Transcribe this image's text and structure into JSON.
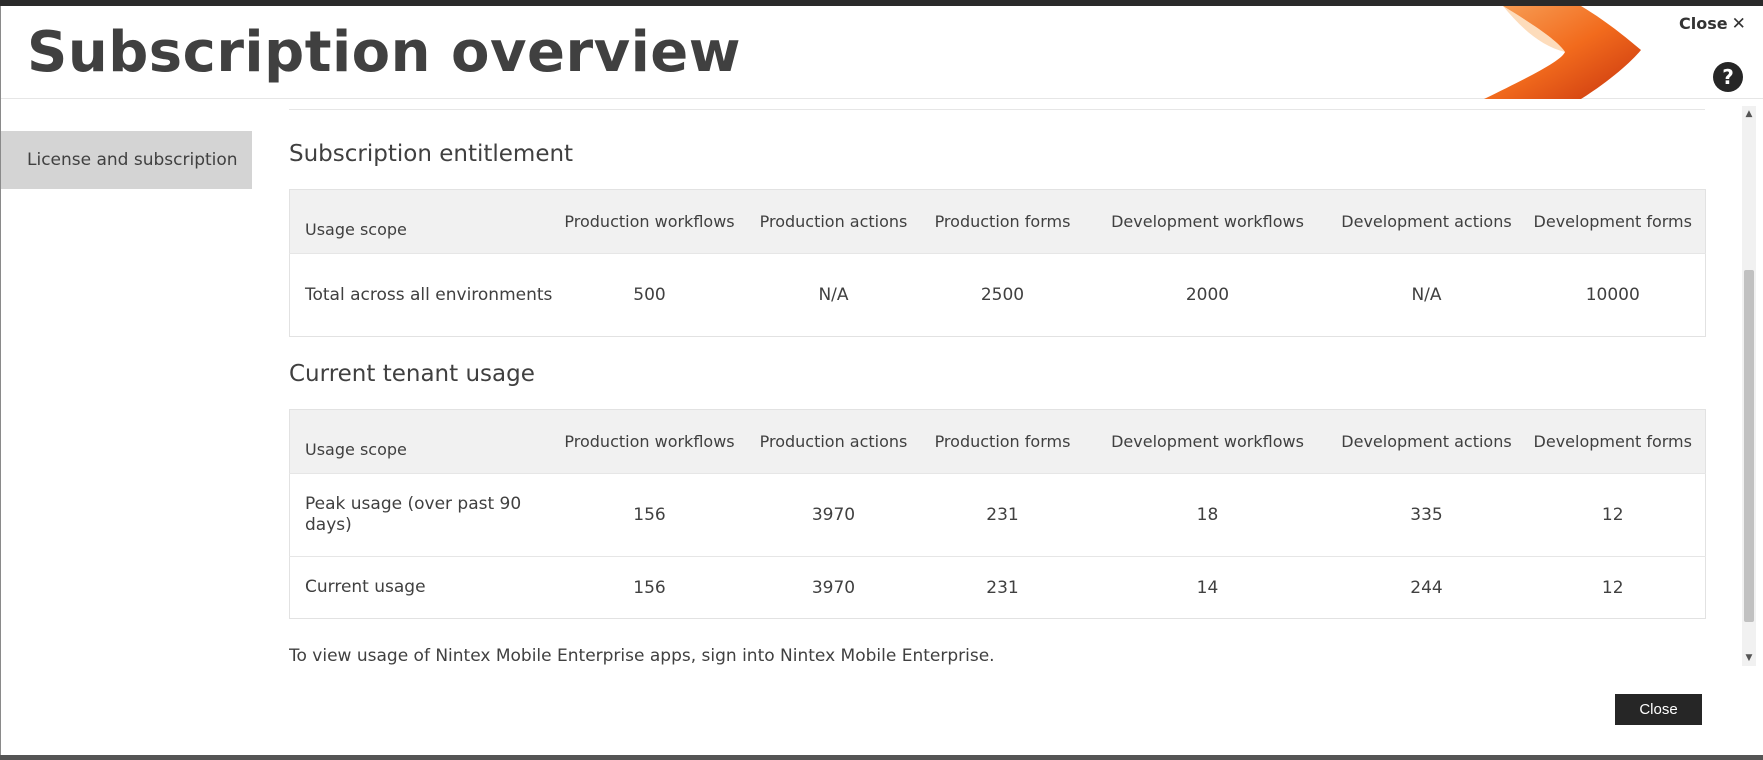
{
  "header": {
    "title": "Subscription overview",
    "close_label": "Close",
    "close_symbol": "✕",
    "help_symbol": "?"
  },
  "sidebar": {
    "items": [
      {
        "label": "License and subscription",
        "selected": true
      }
    ]
  },
  "entitlement": {
    "title": "Subscription entitlement",
    "columns": {
      "scope": "Usage scope",
      "prod_workflows": "Production workflows",
      "prod_actions": "Production actions",
      "prod_forms": "Production forms",
      "dev_workflows": "Development workflows",
      "dev_actions": "Development actions",
      "dev_forms": "Development forms"
    },
    "rows": [
      {
        "scope": "Total across all environments",
        "prod_workflows": "500",
        "prod_actions": "N/A",
        "prod_forms": "2500",
        "dev_workflows": "2000",
        "dev_actions": "N/A",
        "dev_forms": "10000"
      }
    ]
  },
  "usage": {
    "title": "Current tenant usage",
    "columns": {
      "scope": "Usage scope",
      "prod_workflows": "Production workflows",
      "prod_actions": "Production actions",
      "prod_forms": "Production forms",
      "dev_workflows": "Development workflows",
      "dev_actions": "Development actions",
      "dev_forms": "Development forms"
    },
    "rows": [
      {
        "scope": "Peak usage (over past 90 days)",
        "prod_workflows": "156",
        "prod_actions": "3970",
        "prod_forms": "231",
        "dev_workflows": "18",
        "dev_actions": "335",
        "dev_forms": "12"
      },
      {
        "scope": "Current usage",
        "prod_workflows": "156",
        "prod_actions": "3970",
        "prod_forms": "231",
        "dev_workflows": "14",
        "dev_actions": "244",
        "dev_forms": "12"
      }
    ]
  },
  "notes": {
    "mobile": "To view usage of Nintex Mobile Enterprise apps, sign into Nintex Mobile Enterprise."
  },
  "footer": {
    "close_label": "Close"
  },
  "colors": {
    "accent_logo": "#f26b1d",
    "button_bg": "#262626",
    "sidebar_selected": "#d4d4d4"
  }
}
